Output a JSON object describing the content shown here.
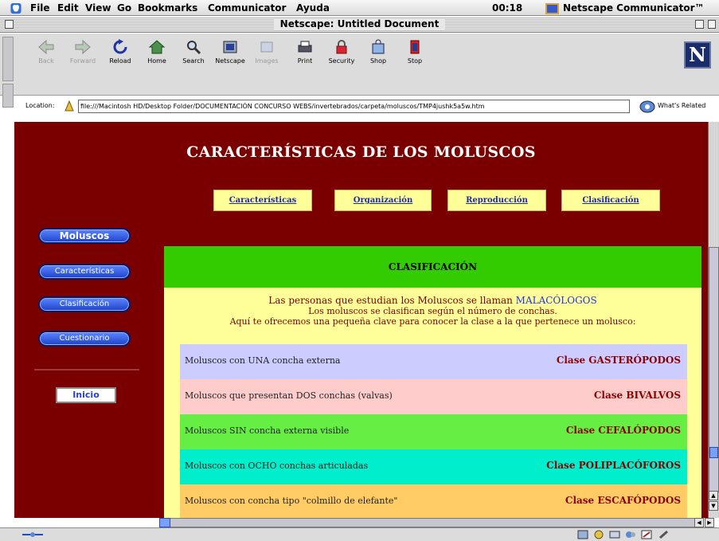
{
  "menubar": {
    "items": [
      {
        "label": "File"
      },
      {
        "label": "Edit"
      },
      {
        "label": "View"
      },
      {
        "label": "Go"
      },
      {
        "label": "Bookmarks"
      },
      {
        "label": "Communicator"
      },
      {
        "label": "Ayuda"
      }
    ],
    "clock": "00:18",
    "app_name": "Netscape Communicator™"
  },
  "window": {
    "title": "Netscape: Untitled Document"
  },
  "toolbar": {
    "buttons": [
      {
        "label": "Back",
        "icon": "back-arrow-icon",
        "enabled": false
      },
      {
        "label": "Forward",
        "icon": "forward-arrow-icon",
        "enabled": false
      },
      {
        "label": "Reload",
        "icon": "reload-icon",
        "enabled": true
      },
      {
        "label": "Home",
        "icon": "home-icon",
        "enabled": true
      },
      {
        "label": "Search",
        "icon": "search-icon",
        "enabled": true
      },
      {
        "label": "Netscape",
        "icon": "netscape-icon",
        "enabled": true
      },
      {
        "label": "Images",
        "icon": "images-icon",
        "enabled": false
      },
      {
        "label": "Print",
        "icon": "print-icon",
        "enabled": true
      },
      {
        "label": "Security",
        "icon": "security-lock-icon",
        "enabled": true
      },
      {
        "label": "Shop",
        "icon": "shop-bag-icon",
        "enabled": true
      },
      {
        "label": "Stop",
        "icon": "stop-icon",
        "enabled": true
      }
    ],
    "logo_letter": "N"
  },
  "location": {
    "label": "Location:",
    "url": "file:///Macintosh HD/Desktop Folder/DOCUMENTACIÓN CONCURSO WEBS/invertebrados/carpeta/moluscos/TMP4jushk5a5w.htm",
    "related_label": "What's Related"
  },
  "page": {
    "title": "CARACTERÍSTICAS DE LOS MOLUSCOS",
    "top_nav": [
      {
        "label": "Características"
      },
      {
        "label": "Organización"
      },
      {
        "label": "Reproducción"
      },
      {
        "label": "Clasificación"
      }
    ],
    "side_nav": [
      {
        "label": "Moluscos",
        "active": true
      },
      {
        "label": "Características",
        "active": false
      },
      {
        "label": "Clasificación",
        "active": false
      },
      {
        "label": "Cuestionario",
        "active": false
      }
    ],
    "home_button": "Inicio",
    "section_title": "CLASIFICACIÓN",
    "intro": {
      "line1_text": "Las personas que estudian los Moluscos se llaman",
      "line1_highlight": "MALACÓLOGOS",
      "line2": "Los moluscos se clasifican según el número de conchas.",
      "line3": "Aquí te ofrecemos una pequeña clave para conocer la clase a la que pertenece un molusco:"
    },
    "classification_rows": [
      {
        "description": "Moluscos con UNA concha externa",
        "class": "Clase GASTERÓPODOS",
        "bg": "#ccccff"
      },
      {
        "description": "Moluscos que presentan DOS conchas (valvas)",
        "class": "Clase BIVALVOS",
        "bg": "#ffcccc"
      },
      {
        "description": "Moluscos SIN concha externa visible",
        "class": "Clase CEFALÓPODOS",
        "bg": "#66ee44"
      },
      {
        "description": "Moluscos con OCHO conchas articuladas",
        "class": "Clase POLIPLACÓFOROS",
        "bg": "#00eecc"
      },
      {
        "description": "Moluscos con concha tipo \"colmillo de elefante\"",
        "class": "Clase ESCAFÓPODOS",
        "bg": "#ffcc66"
      }
    ]
  },
  "colors": {
    "page_background": "#7a0000",
    "section_header": "#33cc00",
    "panel_background": "#ffff99",
    "nav_tab_background": "#ffff99",
    "link_color": "#1f2b9a",
    "class_label_color": "#8b0000"
  }
}
